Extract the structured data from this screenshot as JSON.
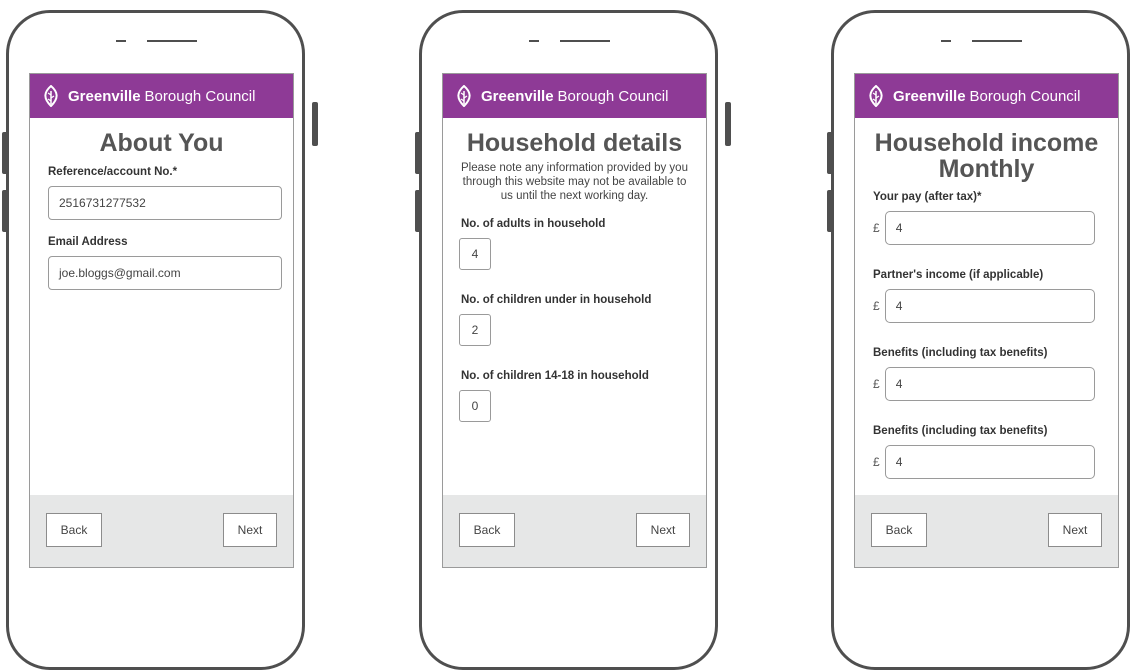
{
  "brand": {
    "name_bold": "Greenville",
    "name_light": "Borough Council",
    "color": "#8e3a96"
  },
  "icons": {
    "logo": "leaf-logo-icon"
  },
  "screen1": {
    "title": "About You",
    "reference": {
      "label": "Reference/account No.*",
      "value": "2516731277532"
    },
    "email": {
      "label": "Email Address",
      "value": "joe.bloggs@gmail.com"
    },
    "back_label": "Back",
    "next_label": "Next"
  },
  "screen2": {
    "title": "Household details",
    "intro": "Please note any information provided by you through this website may not be available to us until the next working day.",
    "adults": {
      "label": "No. of adults in household",
      "value": "4"
    },
    "children_under": {
      "label": "No. of children under in household",
      "value": "2"
    },
    "children_14_18": {
      "label": "No. of children 14-18 in household",
      "value": "0"
    },
    "back_label": "Back",
    "next_label": "Next"
  },
  "screen3": {
    "title": "Household income Monthly",
    "currency_symbol": "£",
    "fields": [
      {
        "label": "Your pay (after tax)*",
        "value": "4"
      },
      {
        "label": "Partner's income (if applicable)",
        "value": "4"
      },
      {
        "label": "Benefits (including tax benefits)",
        "value": "4"
      },
      {
        "label": "Benefits (including tax benefits)",
        "value": "4"
      }
    ],
    "back_label": "Back",
    "next_label": "Next"
  }
}
